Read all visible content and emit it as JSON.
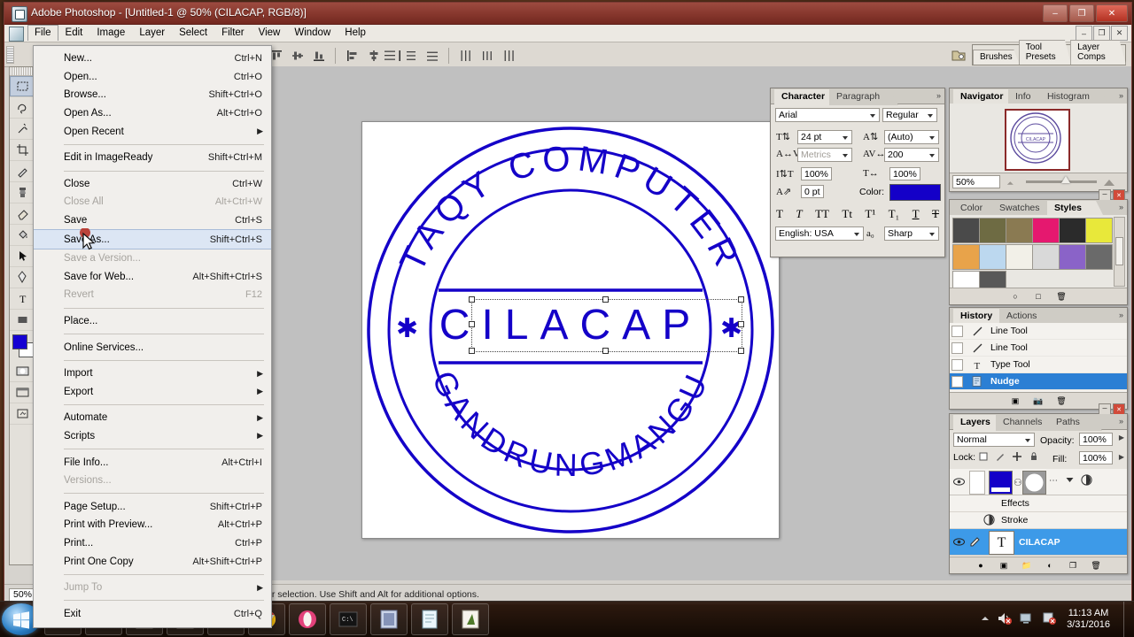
{
  "window": {
    "title": "Adobe Photoshop - [Untitled-1 @ 50% (CILACAP, RGB/8)]",
    "minimize": "–",
    "maximize": "❐",
    "close": "✕",
    "doc_minimize": "–",
    "doc_restore": "❐",
    "doc_close": "✕"
  },
  "menubar": {
    "items": [
      {
        "label": "File",
        "open": true
      },
      {
        "label": "Edit",
        "open": false
      },
      {
        "label": "Image",
        "open": false
      },
      {
        "label": "Layer",
        "open": false
      },
      {
        "label": "Select",
        "open": false
      },
      {
        "label": "Filter",
        "open": false
      },
      {
        "label": "View",
        "open": false
      },
      {
        "label": "Window",
        "open": false
      },
      {
        "label": "Help",
        "open": false
      }
    ]
  },
  "file_menu": {
    "items": [
      {
        "label": "New...",
        "shortcut": "Ctrl+N",
        "disabled": false,
        "submenu": false,
        "highlight": false
      },
      {
        "label": "Open...",
        "shortcut": "Ctrl+O",
        "disabled": false,
        "submenu": false,
        "highlight": false
      },
      {
        "label": "Browse...",
        "shortcut": "Shift+Ctrl+O",
        "disabled": false,
        "submenu": false,
        "highlight": false
      },
      {
        "label": "Open As...",
        "shortcut": "Alt+Ctrl+O",
        "disabled": false,
        "submenu": false,
        "highlight": false
      },
      {
        "label": "Open Recent",
        "shortcut": "",
        "disabled": false,
        "submenu": true,
        "highlight": false
      },
      {
        "separator": true
      },
      {
        "label": "Edit in ImageReady",
        "shortcut": "Shift+Ctrl+M",
        "disabled": false,
        "submenu": false,
        "highlight": false
      },
      {
        "separator": true
      },
      {
        "label": "Close",
        "shortcut": "Ctrl+W",
        "disabled": false,
        "submenu": false,
        "highlight": false
      },
      {
        "label": "Close All",
        "shortcut": "Alt+Ctrl+W",
        "disabled": true,
        "submenu": false,
        "highlight": false
      },
      {
        "label": "Save",
        "shortcut": "Ctrl+S",
        "disabled": false,
        "submenu": false,
        "highlight": false
      },
      {
        "label": "Save As...",
        "shortcut": "Shift+Ctrl+S",
        "disabled": false,
        "submenu": false,
        "highlight": true
      },
      {
        "label": "Save a Version...",
        "shortcut": "",
        "disabled": true,
        "submenu": false,
        "highlight": false
      },
      {
        "label": "Save for Web...",
        "shortcut": "Alt+Shift+Ctrl+S",
        "disabled": false,
        "submenu": false,
        "highlight": false
      },
      {
        "label": "Revert",
        "shortcut": "F12",
        "disabled": true,
        "submenu": false,
        "highlight": false
      },
      {
        "separator": true
      },
      {
        "label": "Place...",
        "shortcut": "",
        "disabled": false,
        "submenu": false,
        "highlight": false
      },
      {
        "separator": true
      },
      {
        "label": "Online Services...",
        "shortcut": "",
        "disabled": false,
        "submenu": false,
        "highlight": false
      },
      {
        "separator": true
      },
      {
        "label": "Import",
        "shortcut": "",
        "disabled": false,
        "submenu": true,
        "highlight": false
      },
      {
        "label": "Export",
        "shortcut": "",
        "disabled": false,
        "submenu": true,
        "highlight": false
      },
      {
        "separator": true
      },
      {
        "label": "Automate",
        "shortcut": "",
        "disabled": false,
        "submenu": true,
        "highlight": false
      },
      {
        "label": "Scripts",
        "shortcut": "",
        "disabled": false,
        "submenu": true,
        "highlight": false
      },
      {
        "separator": true
      },
      {
        "label": "File Info...",
        "shortcut": "Alt+Ctrl+I",
        "disabled": false,
        "submenu": false,
        "highlight": false
      },
      {
        "label": "Versions...",
        "shortcut": "",
        "disabled": true,
        "submenu": false,
        "highlight": false
      },
      {
        "separator": true
      },
      {
        "label": "Page Setup...",
        "shortcut": "Shift+Ctrl+P",
        "disabled": false,
        "submenu": false,
        "highlight": false
      },
      {
        "label": "Print with Preview...",
        "shortcut": "Alt+Ctrl+P",
        "disabled": false,
        "submenu": false,
        "highlight": false
      },
      {
        "label": "Print...",
        "shortcut": "Ctrl+P",
        "disabled": false,
        "submenu": false,
        "highlight": false
      },
      {
        "label": "Print One Copy",
        "shortcut": "Alt+Shift+Ctrl+P",
        "disabled": false,
        "submenu": false,
        "highlight": false
      },
      {
        "separator": true
      },
      {
        "label": "Jump To",
        "shortcut": "",
        "disabled": true,
        "submenu": true,
        "highlight": false
      },
      {
        "separator": true
      },
      {
        "label": "Exit",
        "shortcut": "Ctrl+Q",
        "disabled": false,
        "submenu": false,
        "highlight": false
      }
    ]
  },
  "options_bar": {
    "palette_tabs": [
      "Brushes",
      "Tool Presets",
      "Layer Comps"
    ]
  },
  "canvas": {
    "zoom": "50%",
    "stamp": {
      "top_text": "TAQY COMPUTER",
      "bottom_text": "GANDRUNGMANGU",
      "center_text": "CILACAP",
      "star_left": "✳",
      "star_right": "✳",
      "ink_color": "#1400c8"
    }
  },
  "character_panel": {
    "tabs": [
      "Character",
      "Paragraph"
    ],
    "active_tab": "Character",
    "font_family": "Arial",
    "font_style": "Regular",
    "font_size": "24 pt",
    "leading": "(Auto)",
    "kerning": "Metrics",
    "tracking": "200",
    "vertical_scale": "100%",
    "horizontal_scale": "100%",
    "baseline_shift": "0 pt",
    "color_label": "Color:",
    "color_value": "#1400c8",
    "language": "English: USA",
    "anti_alias": "Sharp",
    "style_buttons": [
      "T",
      "T",
      "TT",
      "Tt",
      "T¹",
      "T₁",
      "T",
      "T"
    ]
  },
  "navigator_panel": {
    "tabs": [
      "Navigator",
      "Info",
      "Histogram"
    ],
    "active_tab": "Navigator",
    "zoom_value": "50%"
  },
  "styles_panel": {
    "tabs": [
      "Color",
      "Swatches",
      "Styles"
    ],
    "active_tab": "Styles",
    "swatches": [
      "#4a4a4a",
      "#6e6b43",
      "#8a7a52",
      "#e5186f",
      "#2b2b2b",
      "#e8e83a",
      "#e8a34a",
      "#bcd8ef",
      "#f2f0e8",
      "#d9d9d9",
      "#8a63c8",
      "#6a6a6a",
      "#ffffff",
      "#585858"
    ]
  },
  "history_panel": {
    "tabs": [
      "History",
      "Actions"
    ],
    "active_tab": "History",
    "states": [
      {
        "label": "Line Tool",
        "icon": "line-tool-icon",
        "selected": false
      },
      {
        "label": "Line Tool",
        "icon": "line-tool-icon",
        "selected": false
      },
      {
        "label": "Type Tool",
        "icon": "type-tool-icon",
        "selected": false
      },
      {
        "label": "Nudge",
        "icon": "nudge-icon",
        "selected": true
      }
    ]
  },
  "layers_panel": {
    "tabs": [
      "Layers",
      "Channels",
      "Paths"
    ],
    "active_tab": "Layers",
    "blend_mode": "Normal",
    "opacity_label": "Opacity:",
    "opacity_value": "100%",
    "lock_label": "Lock:",
    "fill_label": "Fill:",
    "fill_value": "100%",
    "rows": [
      {
        "name": "",
        "type": "shape",
        "selected": false,
        "thumb_color": "#1400c8"
      },
      {
        "name": "Effects",
        "type": "effects",
        "selected": false
      },
      {
        "name": "Stroke",
        "type": "effect-item",
        "selected": false
      },
      {
        "name": "CILACAP",
        "type": "text",
        "selected": true
      }
    ]
  },
  "status_bar": {
    "zoom": "50%",
    "doc_size": "",
    "hint": "rag to move layer or selection.  Use Shift and Alt for additional options."
  },
  "taskbar": {
    "start_label": "Start",
    "apps": [
      "internet-explorer-icon",
      "folder-icon",
      "media-player-icon",
      "photo-viewer-icon",
      "firefox-icon",
      "chrome-icon",
      "opera-icon",
      "terminal-icon",
      "video-editor-icon",
      "notepad-icon",
      "photoshop-icon"
    ],
    "tray": {
      "time": "11:13 AM",
      "date": "3/31/2016"
    }
  }
}
